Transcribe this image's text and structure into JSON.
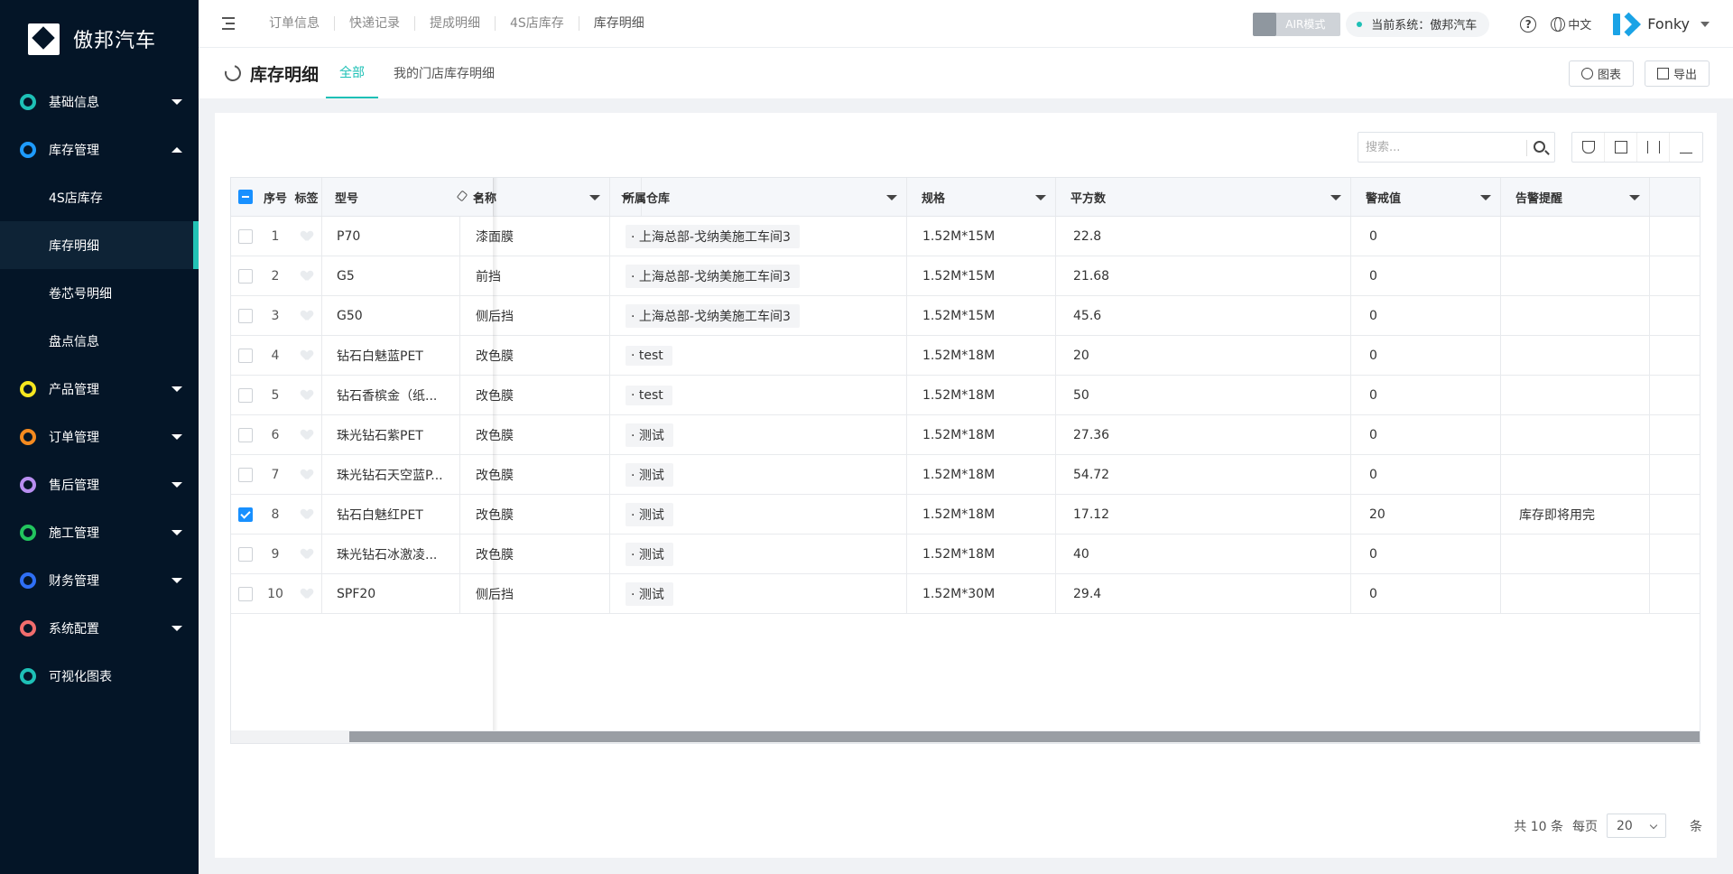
{
  "app": {
    "name": "傲邦汽车"
  },
  "sidebar": {
    "items": [
      {
        "label": "基础信息",
        "color": "#1ec0b6",
        "caret": "down"
      },
      {
        "label": "库存管理",
        "color": "#1e9bff",
        "caret": "up"
      },
      {
        "label": "产品管理",
        "color": "#f5e61f",
        "caret": "down"
      },
      {
        "label": "订单管理",
        "color": "#f58a1f",
        "caret": "down"
      },
      {
        "label": "售后管理",
        "color": "#b88ef0",
        "caret": "down"
      },
      {
        "label": "施工管理",
        "color": "#22c55e",
        "caret": "down"
      },
      {
        "label": "财务管理",
        "color": "#2f6ff5",
        "caret": "down"
      },
      {
        "label": "系统配置",
        "color": "#f26d6d",
        "caret": "down"
      },
      {
        "label": "可视化图表",
        "color": "#1ec0b6",
        "caret": ""
      }
    ],
    "sub_items": [
      "4S店库存",
      "库存明细",
      "卷芯号明细",
      "盘点信息"
    ],
    "active_sub": "库存明细"
  },
  "topbar": {
    "breadcrumbs": [
      "订单信息",
      "快递记录",
      "提成明细",
      "4S店库存",
      "库存明细"
    ],
    "air_mode": "AIR模式",
    "system_label": "当前系统：傲邦汽车",
    "help": "?",
    "language": "中文",
    "user": "Fonky"
  },
  "subheader": {
    "title": "库存明细",
    "tabs": [
      "全部",
      "我的门店库存明细"
    ],
    "chart_button": "图表",
    "export_button": "导出"
  },
  "search": {
    "placeholder": "搜索..."
  },
  "table": {
    "columns": {
      "index": "序号",
      "tag": "标签",
      "model": "型号",
      "name": "名称",
      "warehouse": "所属仓库",
      "spec": "规格",
      "sqm": "平方数",
      "warn": "警戒值",
      "alert": "告警提醒"
    },
    "rows": [
      {
        "index": "1",
        "model": "P70",
        "name": "漆面膜",
        "warehouse": "上海总部-戈纳美施工车间3",
        "spec": "1.52M*15M",
        "sqm": "22.8",
        "warn": "0",
        "alert": "",
        "checked": false
      },
      {
        "index": "2",
        "model": "G5",
        "name": "前挡",
        "warehouse": "上海总部-戈纳美施工车间3",
        "spec": "1.52M*15M",
        "sqm": "21.68",
        "warn": "0",
        "alert": "",
        "checked": false
      },
      {
        "index": "3",
        "model": "G50",
        "name": "侧后挡",
        "warehouse": "上海总部-戈纳美施工车间3",
        "spec": "1.52M*15M",
        "sqm": "45.6",
        "warn": "0",
        "alert": "",
        "checked": false
      },
      {
        "index": "4",
        "model": "钻石白魅蓝PET",
        "name": "改色膜",
        "warehouse": "test",
        "spec": "1.52M*18M",
        "sqm": "20",
        "warn": "0",
        "alert": "",
        "checked": false
      },
      {
        "index": "5",
        "model": "钻石香槟金（纸...",
        "name": "改色膜",
        "warehouse": "test",
        "spec": "1.52M*18M",
        "sqm": "50",
        "warn": "0",
        "alert": "",
        "checked": false
      },
      {
        "index": "6",
        "model": "珠光钻石紫PET",
        "name": "改色膜",
        "warehouse": "测试",
        "spec": "1.52M*18M",
        "sqm": "27.36",
        "warn": "0",
        "alert": "",
        "checked": false
      },
      {
        "index": "7",
        "model": "珠光钻石天空蓝P...",
        "name": "改色膜",
        "warehouse": "测试",
        "spec": "1.52M*18M",
        "sqm": "54.72",
        "warn": "0",
        "alert": "",
        "checked": false
      },
      {
        "index": "8",
        "model": "钻石白魅红PET",
        "name": "改色膜",
        "warehouse": "测试",
        "spec": "1.52M*18M",
        "sqm": "17.12",
        "warn": "20",
        "alert": "库存即将用完",
        "checked": true
      },
      {
        "index": "9",
        "model": "珠光钻石冰激凌...",
        "name": "改色膜",
        "warehouse": "测试",
        "spec": "1.52M*18M",
        "sqm": "40",
        "warn": "0",
        "alert": "",
        "checked": false
      },
      {
        "index": "10",
        "model": "SPF20",
        "name": "侧后挡",
        "warehouse": "测试",
        "spec": "1.52M*30M",
        "sqm": "29.4",
        "warn": "0",
        "alert": "",
        "checked": false
      }
    ]
  },
  "pagination": {
    "total": "共 10 条",
    "per_page_label": "每页",
    "per_page": "20",
    "unit": "条"
  }
}
